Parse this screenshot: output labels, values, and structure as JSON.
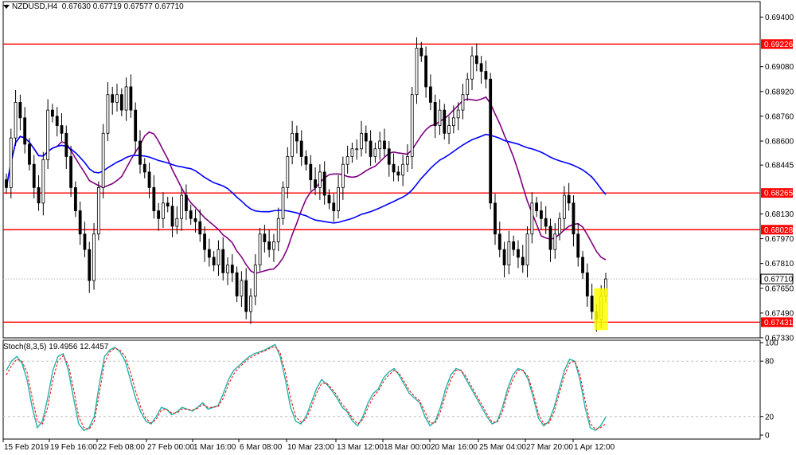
{
  "main_header": {
    "symbol": "NZDUSD,H4",
    "ohlc": "0.67630 0.67719 0.67577 0.67710"
  },
  "sub_header": {
    "label": "Stoch(8,3,5) 19.4956 12.4457"
  },
  "colors": {
    "candle": "#000000",
    "level_line": "#ff0000",
    "level_tag_bg": "#ff0000",
    "current_tag_bg": "#ffffff",
    "ma_fast": "#800080",
    "ma_slow": "#0000ff",
    "stoch_main": "#20b2aa",
    "stoch_signal": "#ff0000",
    "highlight": "#ffff00",
    "grid_dotted": "#c0c0c0"
  },
  "chart_data": [
    {
      "type": "candlestick",
      "title": "NZDUSD,H4",
      "ylim": [
        0.6733,
        0.695
      ],
      "y_ticks": [
        "0.69400",
        "0.69080",
        "0.68920",
        "0.68760",
        "0.68600",
        "0.68445",
        "0.68130",
        "0.67970",
        "0.67810",
        "0.67650",
        "0.67490",
        "0.67330"
      ],
      "x_ticks": [
        "15 Feb 2019",
        "19 Feb 16:00",
        "22 Feb 08:00",
        "27 Feb 00:00",
        "1 Mar 16:00",
        "6 Mar 08:00",
        "10 Mar 23:00",
        "13 Mar 12:00",
        "18 Mar 00:00",
        "20 Mar 16:00",
        "25 Mar 04:00",
        "27 Mar 20:00",
        "1 Apr 12:00"
      ],
      "levels": [
        {
          "label": "0.69226",
          "value": 0.69226
        },
        {
          "label": "0.68265",
          "value": 0.68265
        },
        {
          "label": "0.68028",
          "value": 0.68028
        },
        {
          "label": "0.67431",
          "value": 0.67431
        }
      ],
      "current_price": {
        "label": "0.67710",
        "value": 0.6771
      },
      "candle_closes": [
        0.683,
        0.6862,
        0.6885,
        0.6875,
        0.6858,
        0.6845,
        0.683,
        0.682,
        0.6848,
        0.688,
        0.6876,
        0.687,
        0.6865,
        0.685,
        0.683,
        0.6815,
        0.68,
        0.679,
        0.677,
        0.68,
        0.683,
        0.6865,
        0.689,
        0.6885,
        0.689,
        0.688,
        0.6895,
        0.688,
        0.686,
        0.6845,
        0.684,
        0.683,
        0.6815,
        0.681,
        0.682,
        0.6818,
        0.6805,
        0.681,
        0.6825,
        0.6815,
        0.681,
        0.6808,
        0.68,
        0.679,
        0.6785,
        0.678,
        0.679,
        0.6775,
        0.678,
        0.6775,
        0.676,
        0.677,
        0.675,
        0.676,
        0.678,
        0.68,
        0.6795,
        0.679,
        0.6795,
        0.681,
        0.683,
        0.685,
        0.6865,
        0.686,
        0.685,
        0.6845,
        0.6835,
        0.683,
        0.684,
        0.6825,
        0.682,
        0.6815,
        0.683,
        0.6845,
        0.685,
        0.6855,
        0.6855,
        0.6865,
        0.686,
        0.685,
        0.6855,
        0.686,
        0.6855,
        0.6845,
        0.684,
        0.6838,
        0.6845,
        0.685,
        0.689,
        0.692,
        0.6915,
        0.6895,
        0.6885,
        0.687,
        0.688,
        0.6865,
        0.687,
        0.6875,
        0.688,
        0.689,
        0.69,
        0.6915,
        0.691,
        0.6905,
        0.69,
        0.682,
        0.68,
        0.679,
        0.678,
        0.6795,
        0.679,
        0.6785,
        0.678,
        0.68,
        0.682,
        0.6815,
        0.681,
        0.6805,
        0.679,
        0.68,
        0.681,
        0.6825,
        0.682,
        0.68,
        0.6785,
        0.6775,
        0.676,
        0.675,
        0.6745,
        0.676,
        0.6771
      ],
      "stochastic": {
        "name": "Stoch(8,3,5)",
        "ylim": [
          0,
          100
        ],
        "y_ticks": [
          "100",
          "80",
          "20",
          "0"
        ],
        "main": [
          70,
          80,
          85,
          78,
          60,
          30,
          8,
          15,
          40,
          70,
          85,
          88,
          70,
          40,
          12,
          5,
          8,
          20,
          55,
          85,
          92,
          95,
          90,
          80,
          60,
          40,
          25,
          15,
          12,
          20,
          30,
          28,
          22,
          25,
          30,
          28,
          26,
          30,
          35,
          28,
          30,
          32,
          45,
          60,
          70,
          75,
          80,
          85,
          88,
          90,
          92,
          95,
          98,
          85,
          60,
          30,
          15,
          12,
          20,
          35,
          50,
          60,
          55,
          48,
          40,
          30,
          25,
          15,
          10,
          20,
          35,
          45,
          50,
          62,
          68,
          72,
          65,
          55,
          45,
          40,
          35,
          20,
          10,
          15,
          30,
          50,
          65,
          72,
          70,
          60,
          50,
          40,
          30,
          20,
          12,
          15,
          30,
          50,
          65,
          72,
          70,
          60,
          40,
          18,
          10,
          15,
          30,
          50,
          70,
          82,
          80,
          60,
          30,
          8,
          5,
          10,
          19.5
        ],
        "signal": [
          65,
          75,
          82,
          80,
          68,
          40,
          15,
          12,
          30,
          60,
          80,
          86,
          76,
          50,
          20,
          8,
          6,
          15,
          45,
          78,
          90,
          94,
          92,
          85,
          68,
          48,
          30,
          18,
          13,
          17,
          27,
          28,
          24,
          24,
          28,
          28,
          27,
          29,
          33,
          30,
          30,
          31,
          40,
          55,
          66,
          73,
          78,
          83,
          86,
          89,
          91,
          94,
          96,
          89,
          68,
          40,
          20,
          14,
          17,
          30,
          45,
          56,
          56,
          50,
          43,
          33,
          27,
          18,
          12,
          17,
          30,
          41,
          48,
          58,
          65,
          70,
          67,
          58,
          48,
          42,
          37,
          25,
          13,
          13,
          25,
          44,
          60,
          70,
          70,
          63,
          53,
          43,
          33,
          23,
          14,
          14,
          25,
          45,
          60,
          70,
          70,
          63,
          45,
          23,
          12,
          13,
          25,
          45,
          64,
          78,
          80,
          66,
          38,
          13,
          6,
          8,
          12.4
        ]
      }
    }
  ]
}
